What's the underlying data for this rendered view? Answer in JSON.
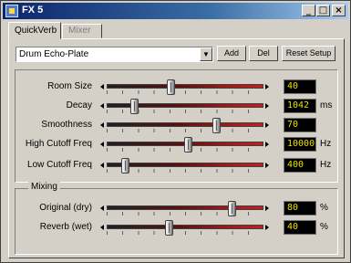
{
  "window": {
    "title": "FX 5",
    "minimize": "_",
    "maximize": "□",
    "close": "×"
  },
  "tabs": [
    {
      "label": "QuickVerb",
      "active": true
    },
    {
      "label": "Mixer",
      "active": false
    }
  ],
  "preset": {
    "value": "Drum Echo-Plate",
    "add_label": "Add",
    "del_label": "Del",
    "reset_label": "Reset Setup"
  },
  "sliders": [
    {
      "label": "Room Size",
      "value": "40",
      "unit": "",
      "level": 0.41
    },
    {
      "label": "Decay",
      "value": "1042",
      "unit": "ms",
      "level": 0.18
    },
    {
      "label": "Smoothness",
      "value": "70",
      "unit": "",
      "level": 0.7
    },
    {
      "label": "High Cutoff Freq",
      "value": "10000",
      "unit": "Hz",
      "level": 0.52
    },
    {
      "label": "Low Cutoff Freq",
      "value": "400",
      "unit": "Hz",
      "level": 0.12
    }
  ],
  "mixing": {
    "group_label": "Mixing",
    "sliders": [
      {
        "label": "Original (dry)",
        "value": "80",
        "unit": "%",
        "level": 0.8
      },
      {
        "label": "Reverb (wet)",
        "value": "40",
        "unit": "%",
        "level": 0.4
      }
    ]
  },
  "colors": {
    "title_gradient_start": "#0a246a",
    "readout_text": "#e8e000",
    "track_red": "#c02020"
  }
}
